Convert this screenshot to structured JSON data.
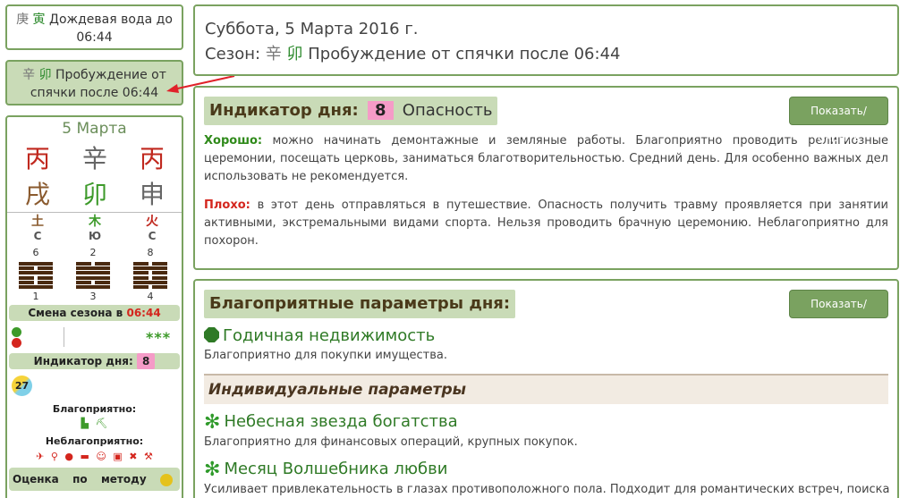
{
  "left": {
    "season_prev": {
      "stem": "庚",
      "branch": "寅",
      "text": "Дождевая вода до 06:44"
    },
    "season_next": {
      "stem": "辛",
      "branch": "卯",
      "text": "Пробуждение от спячки после 06:44"
    },
    "day_card": {
      "date": "5 Марта",
      "stems": [
        "丙",
        "辛",
        "丙"
      ],
      "branches": [
        "戌",
        "卯",
        "申"
      ],
      "elements": [
        "土",
        "木",
        "火"
      ],
      "element_letters": [
        "С",
        "Ю",
        "С"
      ],
      "top_numbers": [
        "6",
        "2",
        "8"
      ],
      "bottom_numbers": [
        "1",
        "3",
        "4"
      ],
      "season_change_label": "Смена сезона в",
      "season_change_time": "06:44",
      "stars": "***",
      "indicator_label": "Индикатор дня:",
      "indicator_value": "8",
      "circle_value": "27",
      "favorable_label": "Благоприятно:",
      "unfavorable_label": "Неблагоприятно:",
      "method_label": "Оценка по методу"
    }
  },
  "date_box": {
    "date": "Суббота, 5 Марта 2016 г.",
    "season_prefix": "Сезон:",
    "season_stem": "辛",
    "season_branch": "卯",
    "season_text": "Пробуждение от спячки после 06:44"
  },
  "indicator": {
    "title": "Индикатор дня:",
    "value": "8",
    "value_label": "Опасность",
    "button": "Показать/Скрыть",
    "good_label": "Хорошо:",
    "good_text": "можно начинать демонтажные и земляные работы. Благоприятно проводить религиозные церемонии, посещать церковь, заниматься благотворительностью. Средний день. Для особенно важных дел использовать не рекомендуется.",
    "bad_label": "Плохо:",
    "bad_text": "в этот день отправляться в путешествие. Опасность получить травму проявляется при занятии активными, экстремальными видами спорта.  Нельзя проводить брачную церемонию.  Неблагоприятно для похорон."
  },
  "params": {
    "title": "Благоприятные параметры дня:",
    "button": "Показать/Скрыть",
    "items": [
      {
        "name": "Годичная недвижимость",
        "desc": "Благоприятно для покупки имущества."
      }
    ],
    "individual_title": "Индивидуальные параметры",
    "individual_items": [
      {
        "name": "Небесная звезда богатства",
        "desc": "Благоприятно для финансовых операций, крупных покупок."
      },
      {
        "name": "Месяц Волшебника любви",
        "desc": "Усиливает привлекательность в глазах противоположного пола. Подходит для романтических встреч, поиска"
      }
    ]
  },
  "colors": {
    "border": "#7aa260",
    "pill": "#c9dbb7",
    "pink": "#f59bc7",
    "red": "#d4261e",
    "green": "#2f7a26"
  }
}
